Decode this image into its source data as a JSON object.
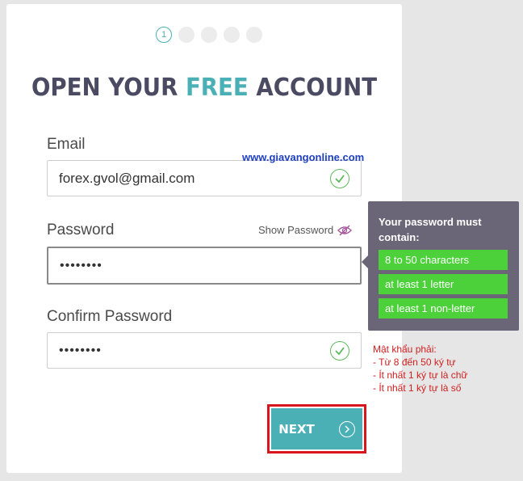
{
  "steps": [
    "1",
    "",
    "",
    "",
    ""
  ],
  "title": {
    "part1": "OPEN YOUR",
    "accent": "FREE",
    "part2": "ACCOUNT"
  },
  "email": {
    "label": "Email",
    "value": "forex.gvol@gmail.com"
  },
  "watermark": "www.giavangonline.com",
  "password": {
    "label": "Password",
    "value": "••••••••",
    "show_label": "Show Password"
  },
  "confirm": {
    "label": "Confirm Password",
    "value": "••••••••"
  },
  "tooltip": {
    "title": "Your password must contain:",
    "requirements": [
      "8 to 50 characters",
      "at least 1 letter",
      "at least 1 non-letter"
    ]
  },
  "note": {
    "heading": "Mật khẩu phải:",
    "lines": [
      "- Từ 8 đến 50 ký tự",
      "- Ít nhất 1 ký tự là chữ",
      "- Ít nhất 1 ký tự là số"
    ]
  },
  "next_label": "NEXT",
  "colors": {
    "accent": "#4ab0b5",
    "valid": "#5cb85c",
    "requirement": "#4cd13b",
    "highlight": "#d8161e"
  }
}
